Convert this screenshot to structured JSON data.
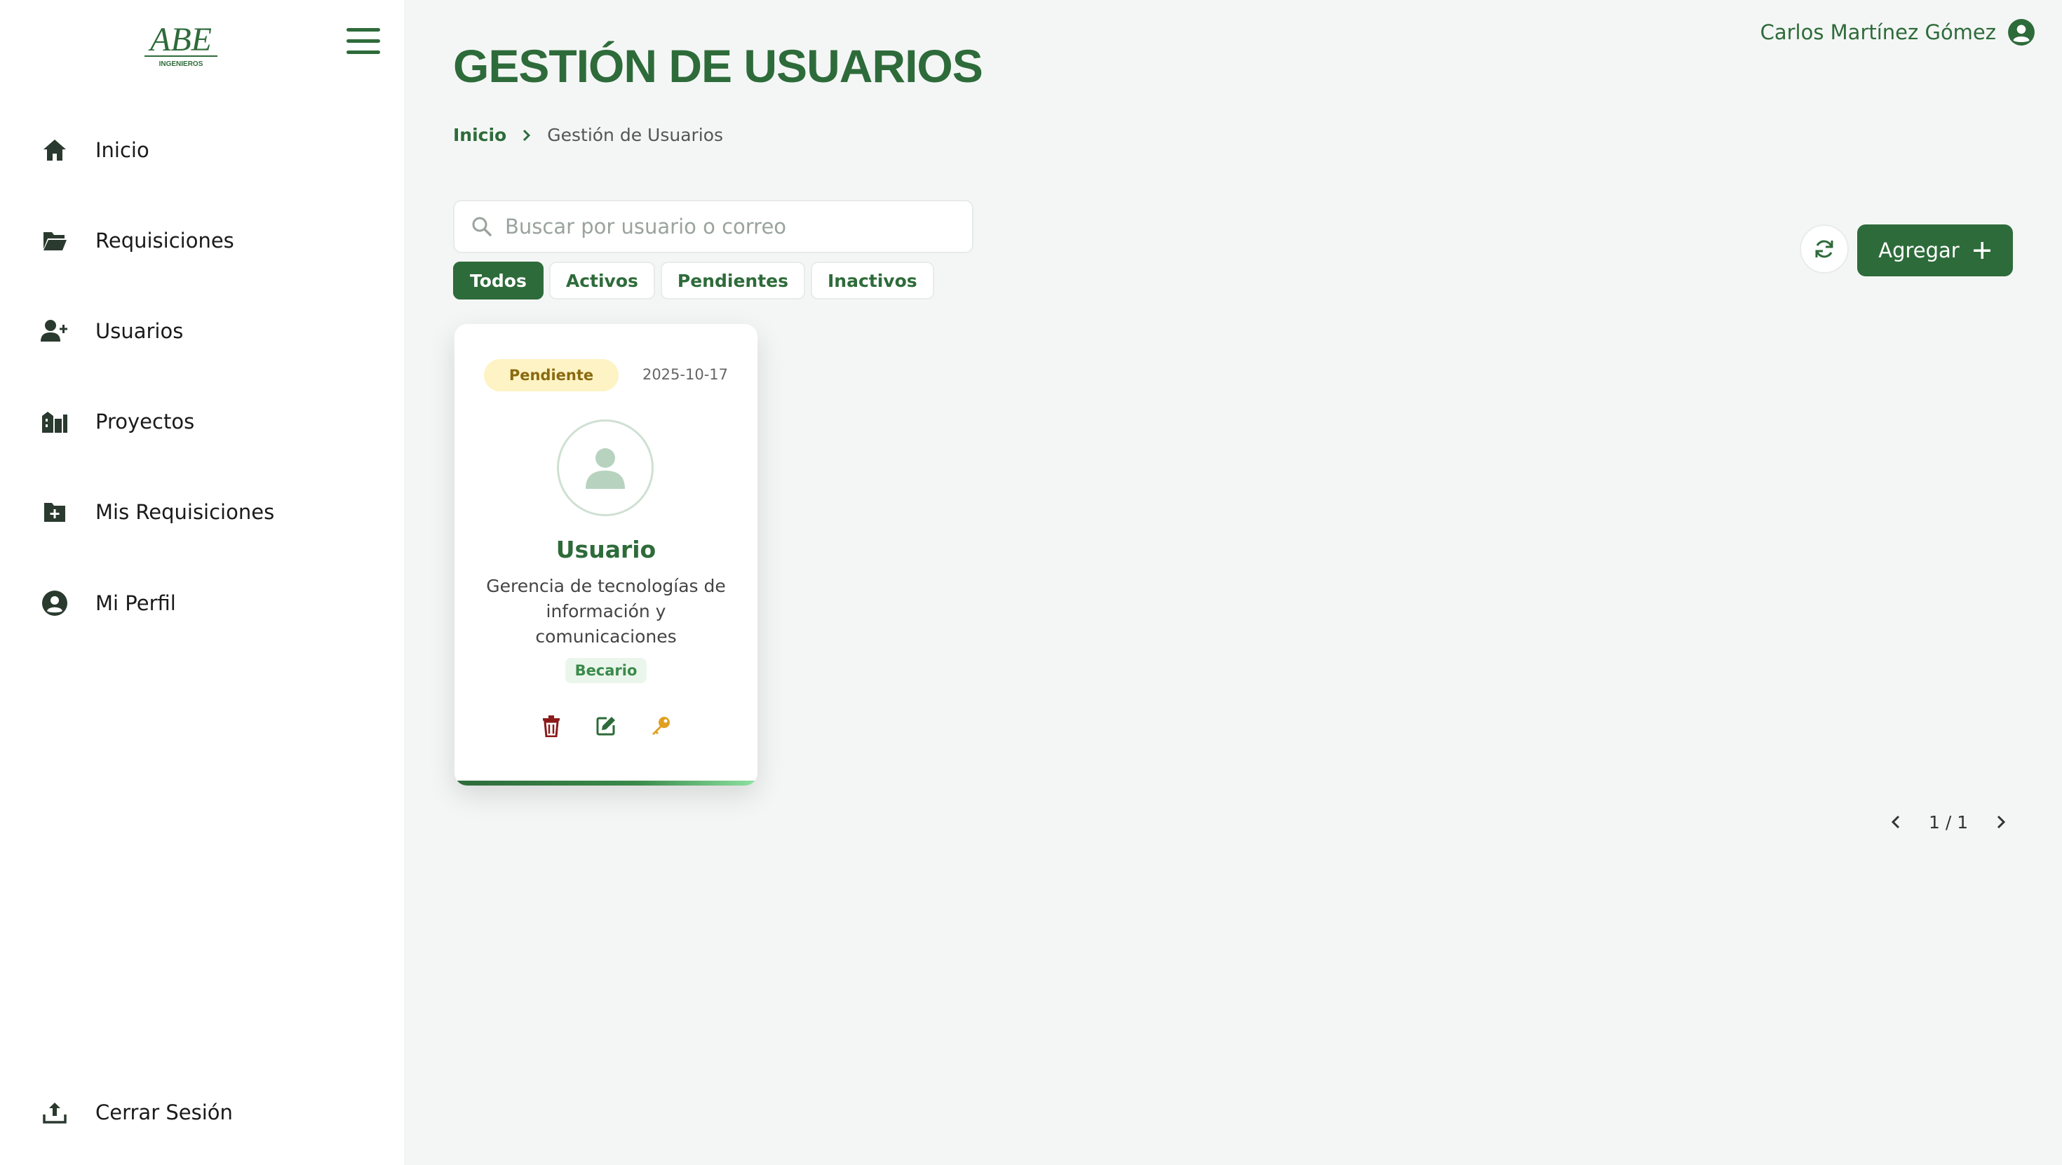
{
  "app": {
    "logo_text": "ABE",
    "logo_subtext": "INGENIEROS",
    "accent_color": "#2e6b3a"
  },
  "sidebar": {
    "items": [
      {
        "label": "Inicio",
        "icon": "home-icon"
      },
      {
        "label": "Requisiciones",
        "icon": "folder-open-icon"
      },
      {
        "label": "Usuarios",
        "icon": "user-plus-icon"
      },
      {
        "label": "Proyectos",
        "icon": "city-icon"
      },
      {
        "label": "Mis Requisiciones",
        "icon": "folder-plus-icon"
      },
      {
        "label": "Mi Perfil",
        "icon": "user-circle-icon"
      }
    ],
    "logout_label": "Cerrar Sesión"
  },
  "header": {
    "title": "GESTIÓN DE USUARIOS",
    "user_name": "Carlos Martínez Gómez"
  },
  "breadcrumb": {
    "home": "Inicio",
    "current": "Gestión de Usuarios"
  },
  "search": {
    "placeholder": "Buscar por usuario o correo",
    "value": ""
  },
  "filters": [
    "Todos",
    "Activos",
    "Pendientes",
    "Inactivos"
  ],
  "active_filter": "Todos",
  "toolbar": {
    "add_label": "Agregar"
  },
  "users": [
    {
      "status": "Pendiente",
      "date": "2025-10-17",
      "name": "Usuario",
      "department": "Gerencia de tecnologías de información y comunicaciones",
      "role": "Becario"
    }
  ],
  "pagination": {
    "text": "1 / 1"
  },
  "colors": {
    "pending_bg": "#fdf3c4",
    "pending_text": "#8a6a10",
    "delete": "#8b1a1a",
    "edit": "#2e6b3a",
    "key": "#e0a020"
  }
}
